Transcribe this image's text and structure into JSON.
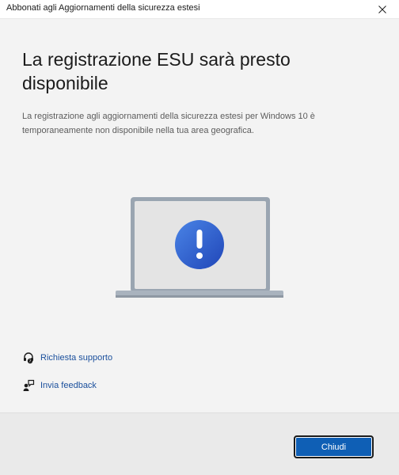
{
  "window": {
    "title": "Abbonati agli Aggiornamenti della sicurezza estesi"
  },
  "main": {
    "heading": "La registrazione ESU sarà presto disponibile",
    "description": "La registrazione agli aggiornamenti della sicurezza estesi per Windows 10 è temporaneamente non disponibile nella tua area geografica.",
    "illustration_icon": "laptop-warning-icon"
  },
  "links": {
    "support_label": "Richiesta supporto",
    "support_icon": "headset-help-icon",
    "feedback_label": "Invia feedback",
    "feedback_icon": "feedback-person-icon"
  },
  "footer": {
    "close_label": "Chiudi"
  },
  "colors": {
    "accent": "#0f5fb5",
    "link": "#1a4f9c",
    "background": "#f3f3f3",
    "footer": "#eaeaea"
  }
}
